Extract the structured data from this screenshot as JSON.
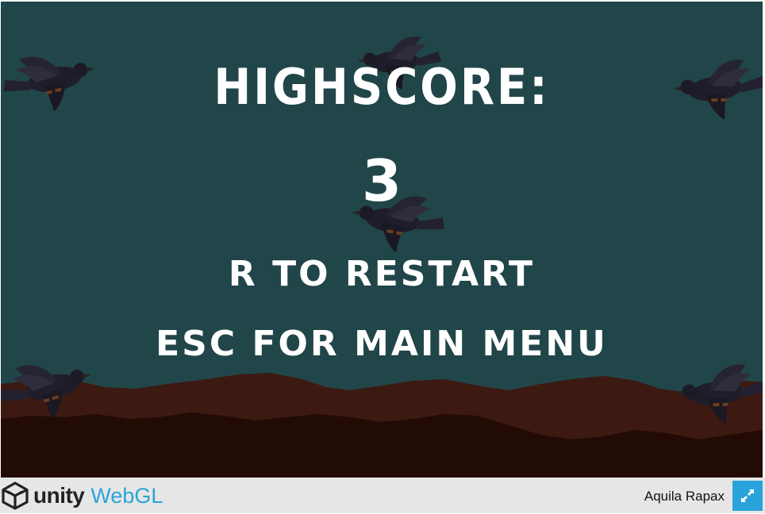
{
  "game": {
    "highscore_label": "HIGHSCORE:",
    "score_value": "3",
    "restart_hint": "R TO RESTART",
    "menu_hint": "ESC FOR MAIN MENU"
  },
  "footer": {
    "unity_label": "unity",
    "webgl_label": "WebGL",
    "game_title": "Aquila Rapax"
  },
  "colors": {
    "sky": "#21464a",
    "hill_far": "#3c1a12",
    "hill_near": "#220b05",
    "text": "#ffffff",
    "footer_bg": "#e6e6e6",
    "webgl_blue": "#2aa4d8",
    "fullscreen_button": "#29a3d9"
  },
  "icons": {
    "logo": "unity-cube-icon",
    "fullscreen": "fullscreen-expand-icon",
    "sprite": "crow-sprite"
  }
}
